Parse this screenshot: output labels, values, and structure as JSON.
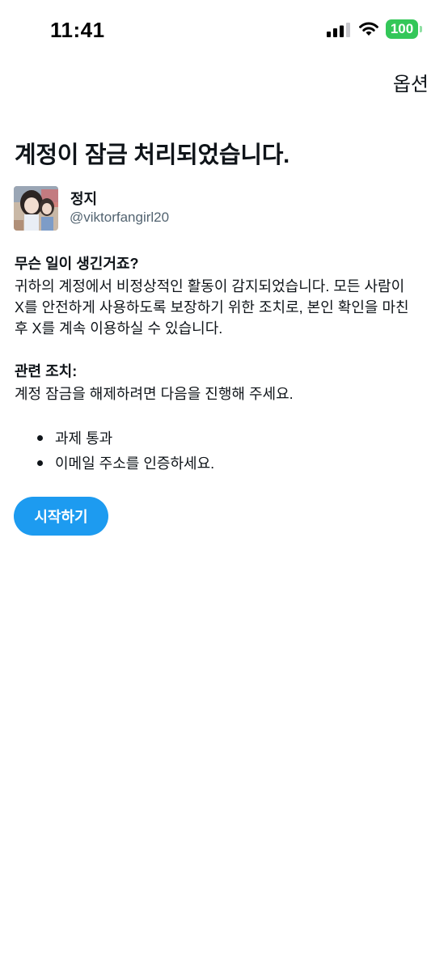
{
  "status_bar": {
    "time": "11:41",
    "battery": "100",
    "icons": [
      "signal-icon",
      "wifi-icon",
      "battery-icon"
    ],
    "battery_color": "#34c759"
  },
  "header": {
    "options_label": "옵션"
  },
  "main": {
    "title": "계정이 잠금 처리되었습니다.",
    "account": {
      "name": "정지",
      "handle": "@viktorfangirl20"
    },
    "what_happened": {
      "heading": "무슨 일이 생긴거죠?",
      "lines": [
        "귀하의 계정에서 비정상적인 활동이 감지되었습니다. 모든 사람이",
        "X를 안전하게 사용하도록 보장하기 위한 조치로, 본인 확인을 마친",
        "후 X를 계속 이용하실 수 있습니다."
      ]
    },
    "related_actions": {
      "heading": "관련 조치:",
      "body": "계정 잠금을 해제하려면 다음을 진행해 주세요.",
      "items": [
        "과제 통과",
        "이메일 주소를 인증하세요."
      ]
    },
    "start_button_label": "시작하기"
  },
  "colors": {
    "accent": "#1d9bf0",
    "text_primary": "#0f1419",
    "text_secondary": "#536471"
  }
}
